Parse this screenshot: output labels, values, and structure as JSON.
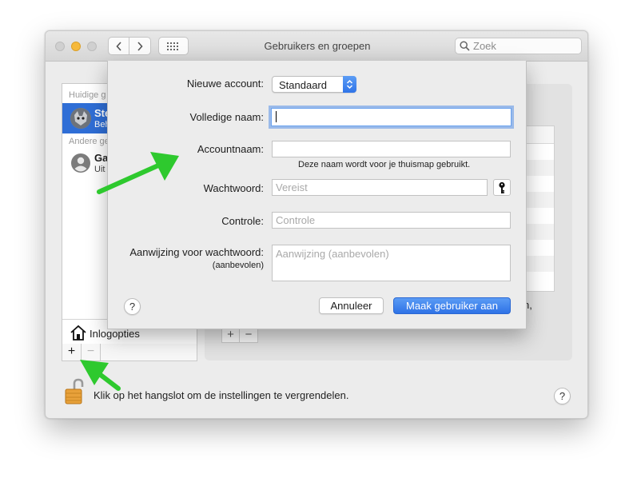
{
  "window": {
    "title": "Gebruikers en groepen",
    "search_placeholder": "Zoek"
  },
  "sidebar": {
    "current_section": "Huidige g",
    "other_section": "Andere ge",
    "users": [
      {
        "name": "Ste",
        "role": "Beh",
        "selected": true
      },
      {
        "name": "Ga",
        "role": "Uit",
        "selected": false
      }
    ],
    "login_options": "Inlogopties",
    "add_symbol": "+",
    "remove_symbol": "−"
  },
  "background": {
    "trailing_text": "n,",
    "add_symbol": "+",
    "remove_symbol": "−"
  },
  "lock_text": "Klik op het hangslot om de instellingen te vergrendelen.",
  "help_label": "?",
  "sheet": {
    "account_type_label": "Nieuwe account:",
    "account_type_value": "Standaard",
    "full_name_label": "Volledige naam:",
    "full_name_value": "",
    "account_name_label": "Accountnaam:",
    "account_name_value": "",
    "account_name_note": "Deze naam wordt voor je thuismap gebruikt.",
    "password_label": "Wachtwoord:",
    "password_placeholder": "Vereist",
    "verify_label": "Controle:",
    "verify_placeholder": "Controle",
    "hint_label": "Aanwijzing voor wachtwoord:",
    "hint_sublabel": "(aanbevolen)",
    "hint_placeholder": "Aanwijzing (aanbevolen)",
    "cancel_label": "Annuleer",
    "create_label": "Maak gebruiker aan"
  },
  "colors": {
    "accent": "#2f74e8",
    "annotation_arrow": "#2ec92e",
    "lock": "#e8a13a"
  }
}
